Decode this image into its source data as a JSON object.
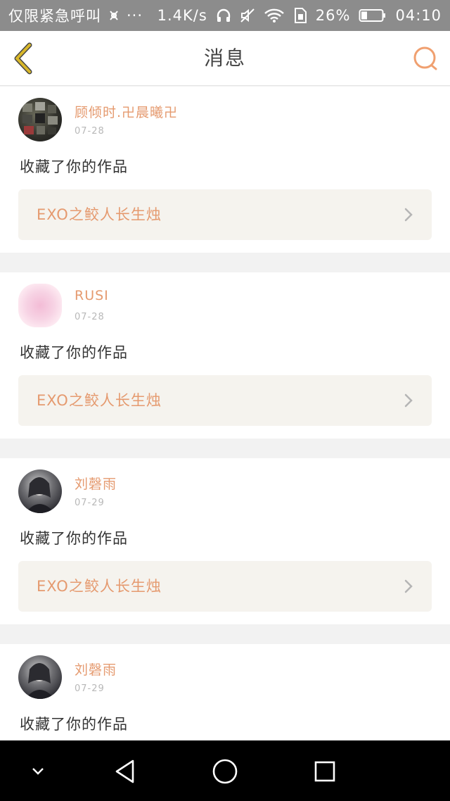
{
  "statusbar": {
    "carrier": "仅限紧急呼叫",
    "dots": "···",
    "speed": "1.4K/s",
    "battery": "26%",
    "time": "04:10"
  },
  "header": {
    "title": "消息"
  },
  "messages": [
    {
      "name": "顾倾时.卍晨曦卍",
      "date": "07-28",
      "action": "收藏了你的作品",
      "work": "EXO之鲛人长生烛"
    },
    {
      "name": "RUSI",
      "date": "07-28",
      "action": "收藏了你的作品",
      "work": "EXO之鲛人长生烛"
    },
    {
      "name": "刘磬雨",
      "date": "07-29",
      "action": "收藏了你的作品",
      "work": "EXO之鲛人长生烛"
    },
    {
      "name": "刘磬雨",
      "date": "07-29",
      "action": "收藏了你的作品"
    }
  ],
  "icons": {
    "back": "chevron-left-icon",
    "search": "search-icon",
    "nav_down": "chevron-down-icon",
    "nav_back": "triangle-back-icon",
    "nav_home": "circle-home-icon",
    "nav_recent": "square-recents-icon"
  },
  "colors": {
    "accent": "#e59a6f",
    "back_arrow": "#d8b72a",
    "statusbar": "#8c8c8c"
  }
}
